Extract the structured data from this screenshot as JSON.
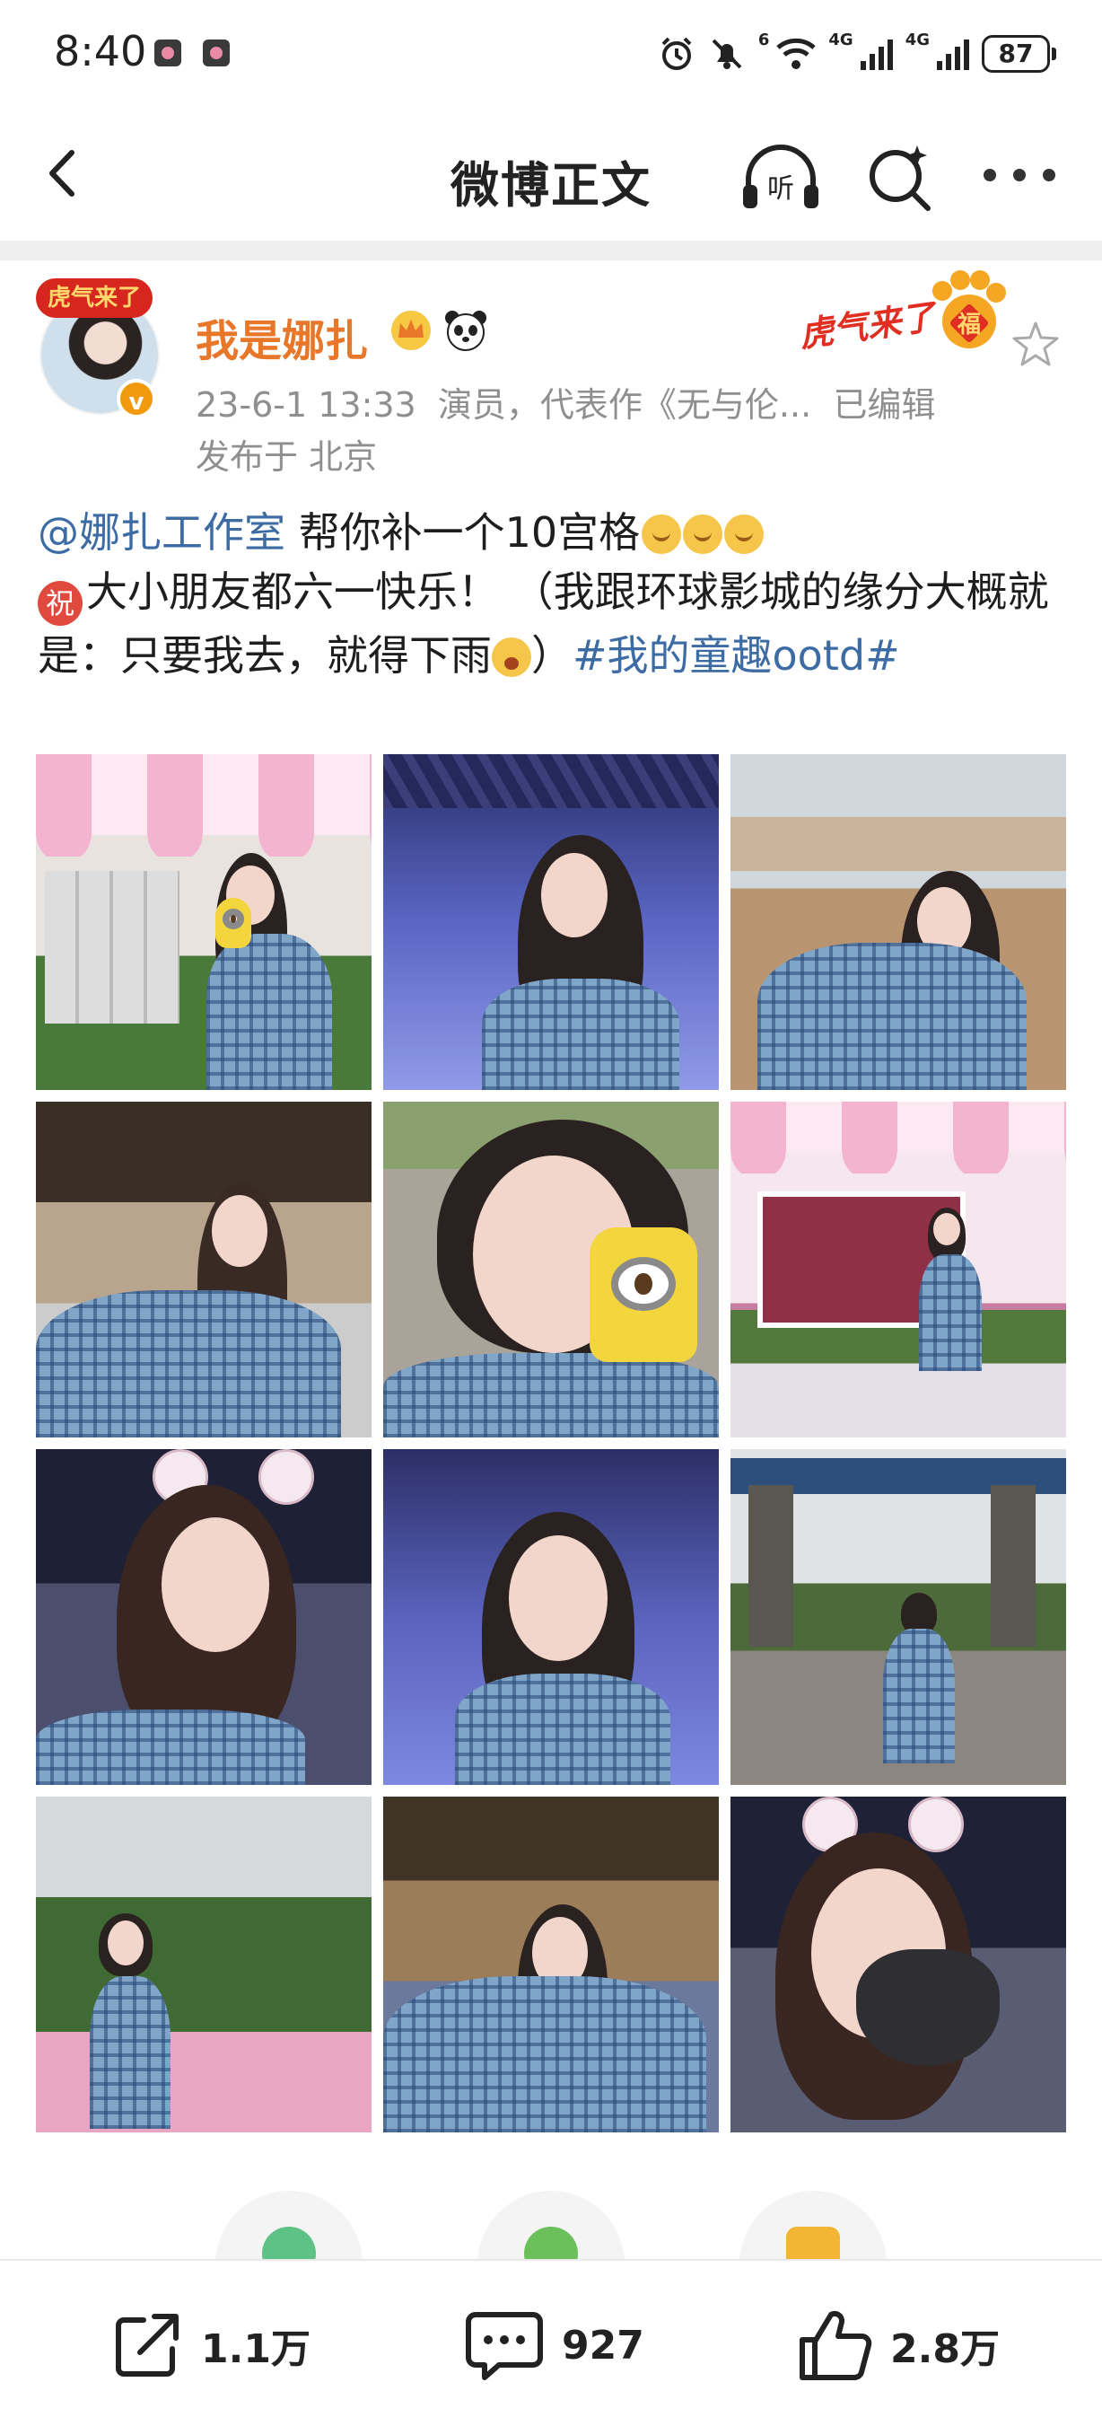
{
  "status_bar": {
    "time": "8:40",
    "net1": "4G",
    "net2": "4G",
    "wifi_tag": "6",
    "battery": "87",
    "icons": [
      "alarm-icon",
      "mute-icon",
      "wifi-icon",
      "signal-icon",
      "signal-icon",
      "battery-icon"
    ]
  },
  "nav": {
    "title": "微博正文",
    "listen_label": "听",
    "icons": [
      "back-icon",
      "listen-icon",
      "search-icon",
      "more-icon"
    ]
  },
  "post": {
    "author": "我是娜扎",
    "avatar_badge": "虎气来了",
    "time": "23-6-1 13:33",
    "bio": "演员，代表作《无与伦...",
    "edited": "已编辑",
    "location": "发布于 北京",
    "decoration_text": "虎气来了",
    "decoration_badge": "福",
    "mention": "@娜扎工作室",
    "text_part1": " 帮你补一个10宫格",
    "zhu_char": "祝",
    "text_part2": "大小朋友都六一快乐！ （我跟环球影城的缘分大概就是：只要我去，就得下雨",
    "text_part3": "）",
    "hashtag": "#我的童趣ootd#",
    "photo_count": 12
  },
  "actions": {
    "repost": "1.1万",
    "comments": "927",
    "likes": "2.8万"
  },
  "colors": {
    "username": "#e8772a",
    "link": "#3d6ba3",
    "meta": "#8f8f8f",
    "verified": "#f29a0e"
  }
}
